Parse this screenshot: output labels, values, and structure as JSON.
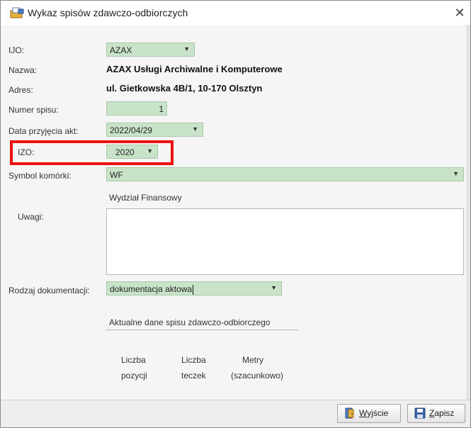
{
  "window": {
    "title": "Wykaz spisów zdawczo-odbiorczych",
    "close_symbol": "✕",
    "icon": "document-box-icon"
  },
  "form": {
    "ijo": {
      "label": "IJO:",
      "value": "AZAX"
    },
    "nazwa": {
      "label": "Nazwa:",
      "value": "AZAX Usługi Archiwalne i Komputerowe"
    },
    "adres": {
      "label": "Adres:",
      "value": "ul. Gietkowska 4B/1, 10-170 Olsztyn"
    },
    "numer_spisu": {
      "label": "Numer spisu:",
      "value": "1"
    },
    "data_przyjecia": {
      "label": "Data przyjęcia akt:",
      "value": "2022/04/29"
    },
    "izo": {
      "label": "IZO:",
      "value": "2020"
    },
    "symbol_komorki": {
      "label": "Symbol komórki:",
      "value": "WF",
      "description": "Wydział Finansowy"
    },
    "uwagi": {
      "label": "Uwagi:",
      "value": ""
    },
    "rodzaj_dokumentacji": {
      "label": "Rodzaj dokumentacji:",
      "value": "dokumentacja aktowa"
    }
  },
  "summary": {
    "heading": "Aktualne dane spisu zdawczo-odbiorczego",
    "col1_line1": "Liczba",
    "col1_line2": "pozycji",
    "col2_line1": "Liczba",
    "col2_line2": "teczek",
    "col3_line1": "Metry",
    "col3_line2": "(szacunkowo)"
  },
  "footer": {
    "exit_label_underlined": "W",
    "exit_label_rest": "yjście",
    "save_label_underlined": "Z",
    "save_label_rest": "apisz"
  },
  "colors": {
    "field_bg": "#c9e3c9",
    "highlight": "#ee1111"
  },
  "arrow": "▼"
}
